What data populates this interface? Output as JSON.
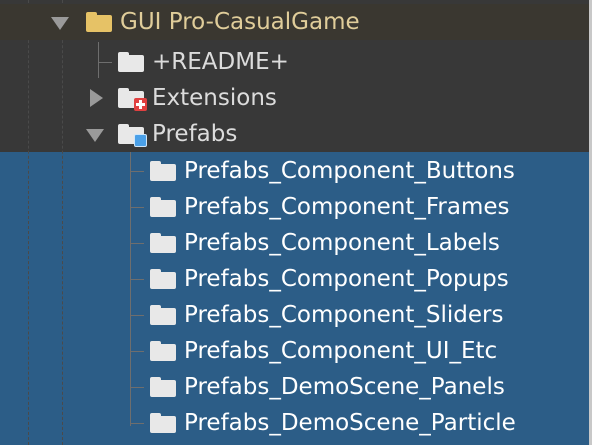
{
  "tree": {
    "root": {
      "label": "GUI Pro-CasualGame",
      "expanded": true,
      "icon": "folder-icon"
    },
    "children": [
      {
        "label": "+README+",
        "icon": "folder-icon",
        "expandable": false
      },
      {
        "label": "Extensions",
        "icon": "folder-plugin-icon",
        "expandable": true,
        "expanded": false
      },
      {
        "label": "Prefabs",
        "icon": "folder-prefab-icon",
        "expandable": true,
        "expanded": true
      }
    ],
    "prefab_children": [
      {
        "label": "Prefabs_Component_Buttons"
      },
      {
        "label": "Prefabs_Component_Frames"
      },
      {
        "label": "Prefabs_Component_Labels"
      },
      {
        "label": "Prefabs_Component_Popups"
      },
      {
        "label": "Prefabs_Component_Sliders"
      },
      {
        "label": "Prefabs_Component_UI_Etc"
      },
      {
        "label": "Prefabs_DemoScene_Panels"
      },
      {
        "label": "Prefabs_DemoScene_Particle"
      }
    ]
  },
  "colors": {
    "background": "#383838",
    "selection": "#2c5d87",
    "root_folder": "#e6c266",
    "folder": "#e8e8e8"
  }
}
